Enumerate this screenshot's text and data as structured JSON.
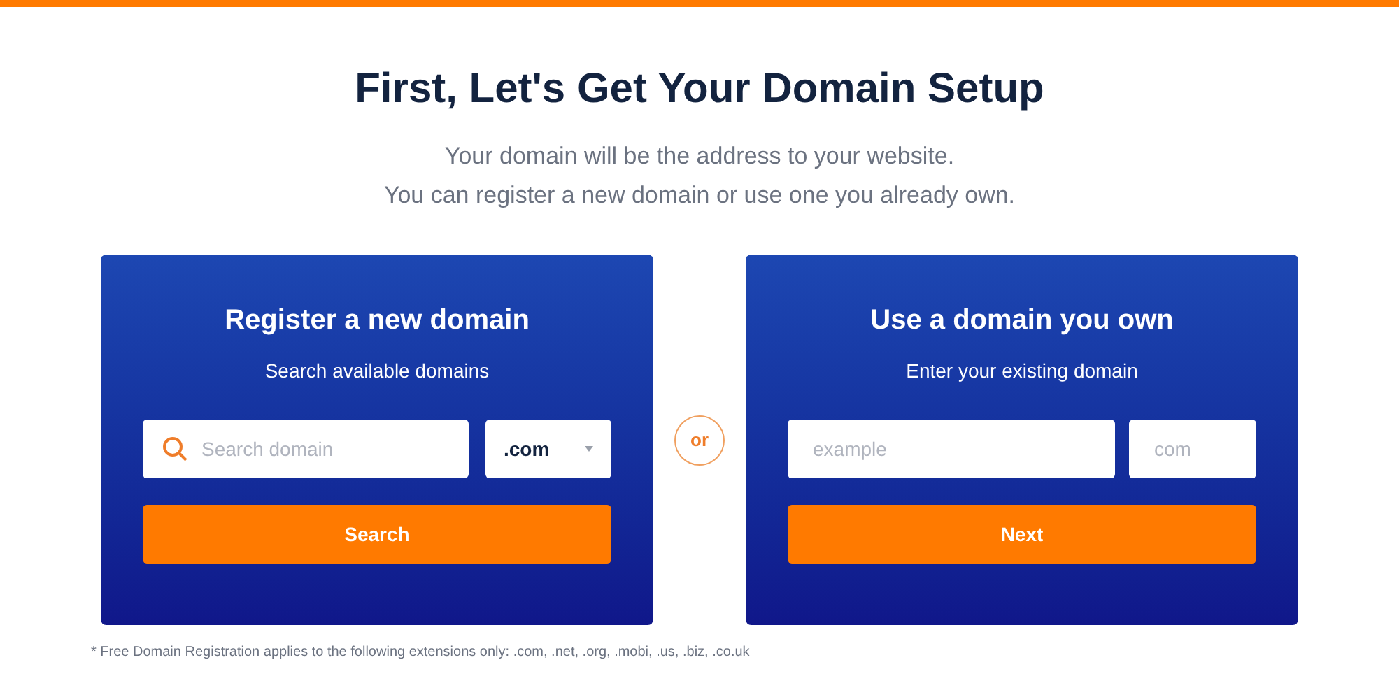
{
  "heading": "First, Let's Get Your Domain Setup",
  "subtitle_lines": [
    "Your domain will be the address to your website.",
    "You can register a new domain or use one you already own."
  ],
  "register_card": {
    "title": "Register a new domain",
    "subtitle": "Search available domains",
    "search_field": {
      "placeholder": "Search domain"
    },
    "extension_select": {
      "value": ".com"
    },
    "button": "Search"
  },
  "separator": "or",
  "own_card": {
    "title": "Use a domain you own",
    "subtitle": "Enter your existing domain",
    "name_field": {
      "placeholder": "example"
    },
    "extension_field": {
      "placeholder": "com"
    },
    "button": "Next"
  },
  "footnote": "* Free Domain Registration applies to the following extensions only: .com, .net, .org, .mobi, .us, .biz, .co.uk"
}
